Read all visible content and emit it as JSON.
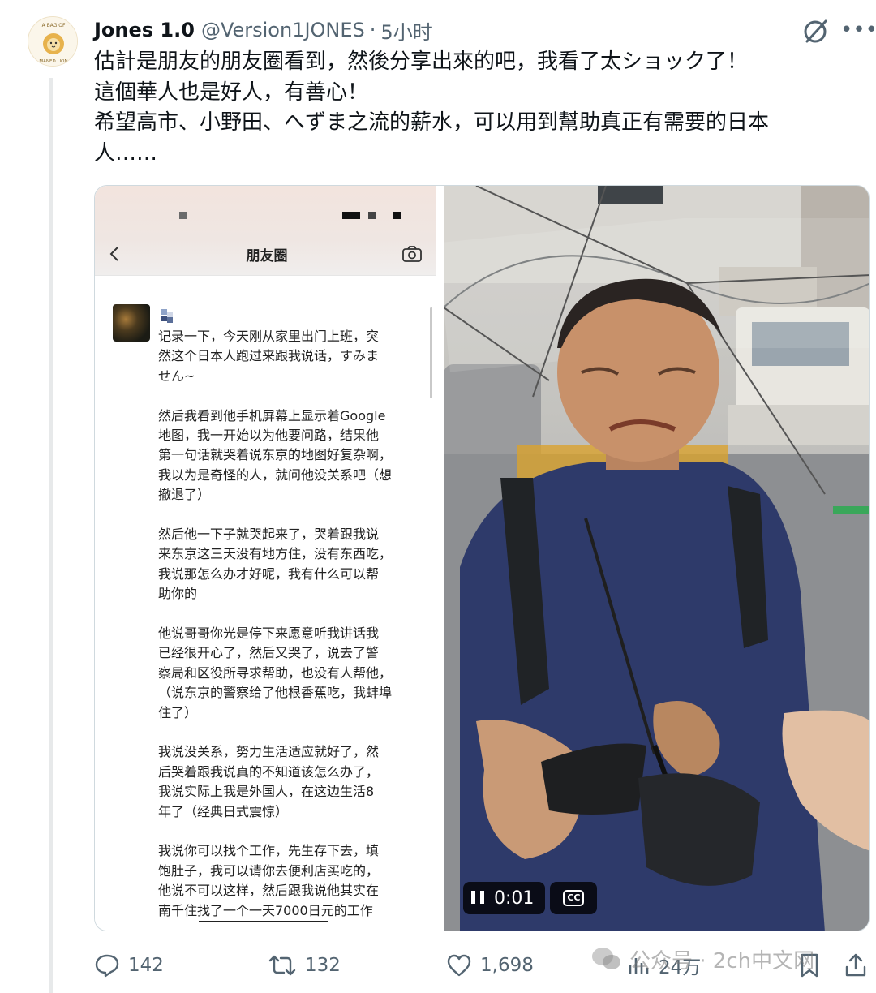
{
  "author": {
    "name": "Jones 1.0",
    "handle": "@Version1JONES",
    "separator": "·",
    "time": "5小时",
    "avatar_text_top": "A BAG OF",
    "avatar_text_bottom": "MANED LION"
  },
  "tweet": {
    "lines": [
      "估計是朋友的朋友圈看到，然後分享出來的吧，我看了太ショック了！",
      "這個華人也是好人，有善心！",
      "希望高市、小野田、へずま之流的薪水，可以用到幫助真正有需要的日本",
      "人……"
    ]
  },
  "phone_screenshot": {
    "title": "朋友圈",
    "paragraphs": [
      "记录一下，今天刚从家里出门上班，突\n然这个日本人跑过来跟我说话，すみま\nせん~",
      "然后我看到他手机屏幕上显示着Google\n地图，我一开始以为他要问路，结果他\n第一句话就哭着说东京的地图好复杂啊，\n我以为是奇怪的人，就问他没关系吧（想\n撤退了）",
      "然后他一下子就哭起来了，哭着跟我说\n来东京这三天没有地方住，没有东西吃，\n我说那怎么办才好呢，我有什么可以帮\n助你的",
      "他说哥哥你光是停下来愿意听我讲话我\n已经很开心了，然后又哭了，说去了警\n察局和区役所寻求帮助，也没有人帮他，\n（说东京的警察给了他根香蕉吃，我蚌埠\n住了）",
      "我说没关系，努力生活适应就好了，然\n后哭着跟我说真的不知道该怎么办了，\n我说实际上我是外国人，在这边生活8\n年了（经典日式震惊）",
      "我说你可以找个工作，先生存下去，填\n饱肚子，我可以请你去便利店买吃的，\n他说不可以这样，然后跟我说他其实在\n南千住找了一个一天7000日元的工作"
    ]
  },
  "video": {
    "time": "0:01",
    "cc_label": "CC"
  },
  "actions": {
    "replies": "142",
    "reposts": "132",
    "likes": "1,698",
    "views": "24万"
  },
  "watermark": {
    "text": "公众号 · 2ch中文网"
  },
  "colors": {
    "text_primary": "#0f1419",
    "text_secondary": "#536471",
    "border": "#cfd9de",
    "shirt": "#2e3a6a"
  }
}
